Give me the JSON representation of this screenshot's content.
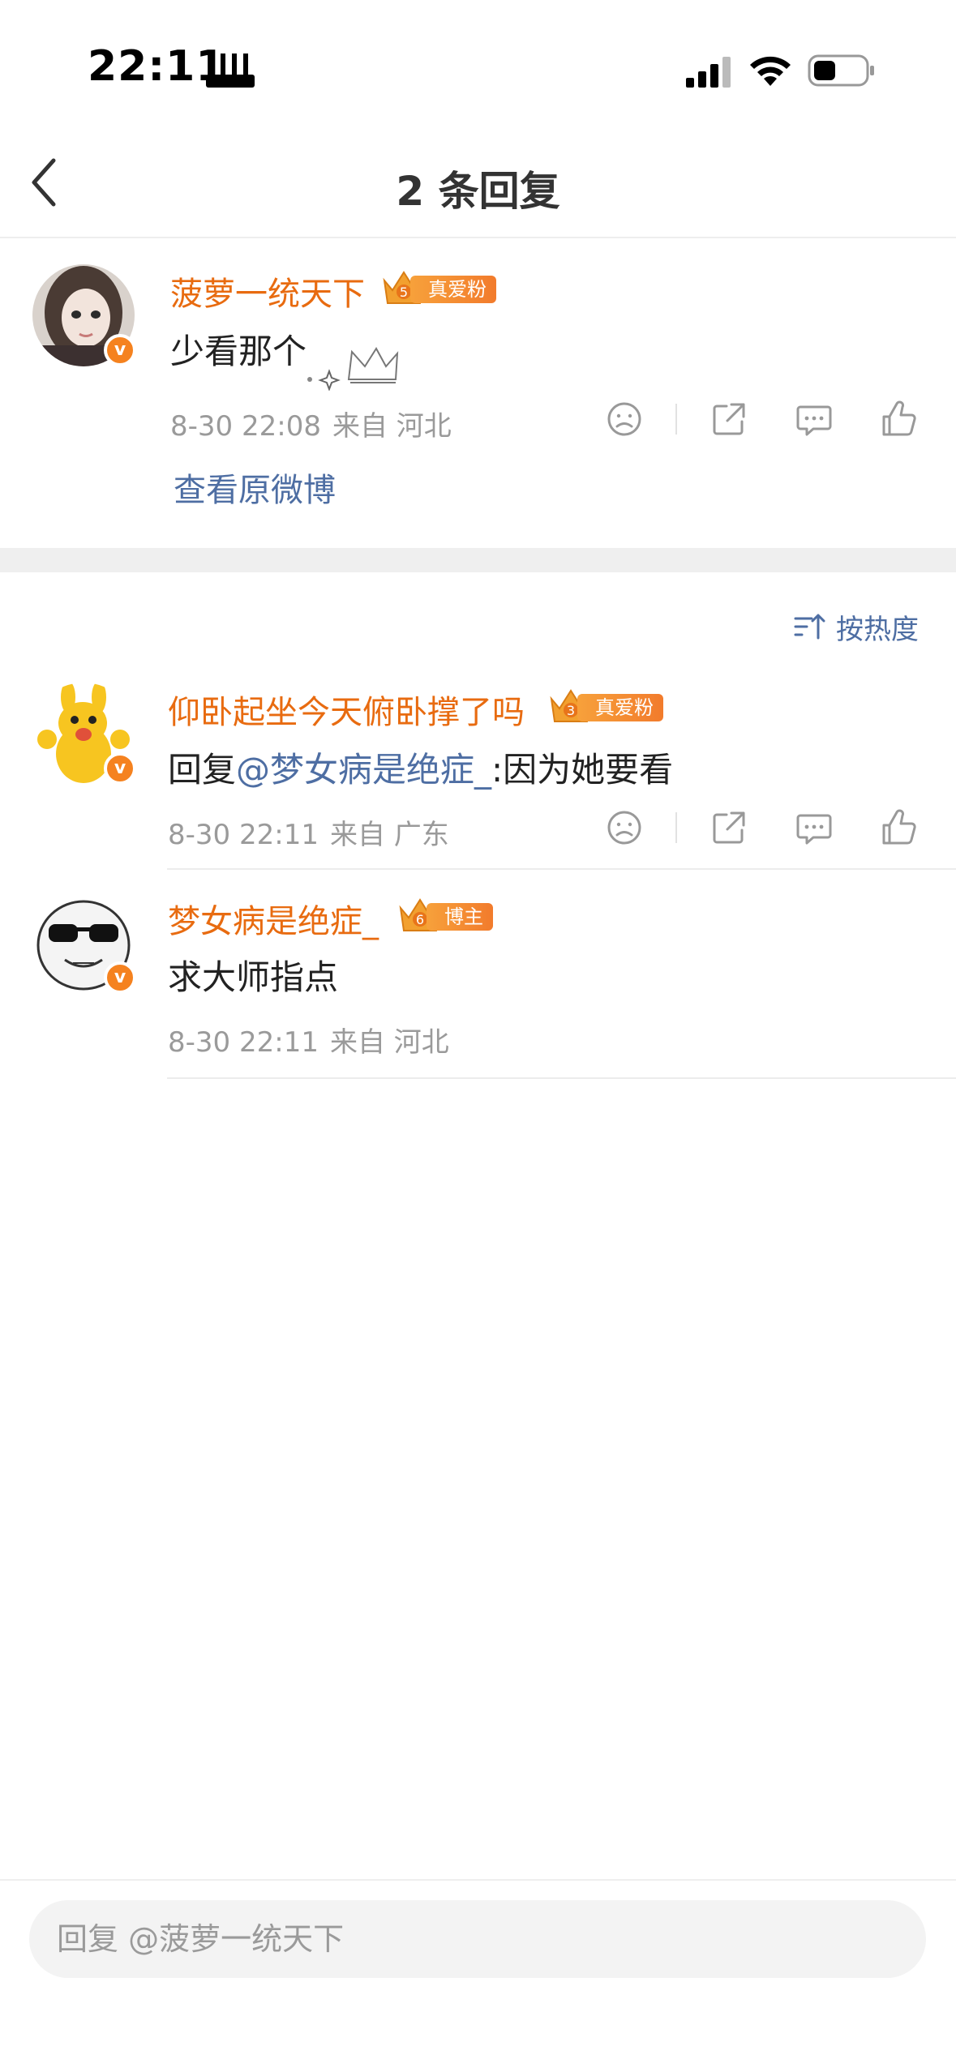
{
  "status_bar": {
    "time": "22:11"
  },
  "header": {
    "title": "2 条回复"
  },
  "original_comment": {
    "username": "菠萝一统天下",
    "fan_level": "5",
    "fan_tag": "真爱粉",
    "content": "少看那个",
    "date": "8-30 22:08",
    "source": "来自 河北",
    "view_original": "查看原微博"
  },
  "sort": {
    "label": "按热度"
  },
  "replies": [
    {
      "username": "仰卧起坐今天俯卧撑了吗",
      "fan_level": "3",
      "fan_tag": "真爱粉",
      "reply_prefix": "回复",
      "mention": "@梦女病是绝症_",
      "text": ":因为她要看",
      "date": "8-30 22:11",
      "source": "来自 广东"
    },
    {
      "username": "梦女病是绝症_",
      "fan_level": "6",
      "fan_tag": "博主",
      "text": "求大师指点",
      "date": "8-30 22:11",
      "source": "来自 河北"
    }
  ],
  "input": {
    "placeholder": "回复 @菠萝一统天下"
  },
  "colors": {
    "username": "#e86b10",
    "mention": "#4e6ea3",
    "meta": "#9a9a9a",
    "badge": "#f5821f"
  }
}
